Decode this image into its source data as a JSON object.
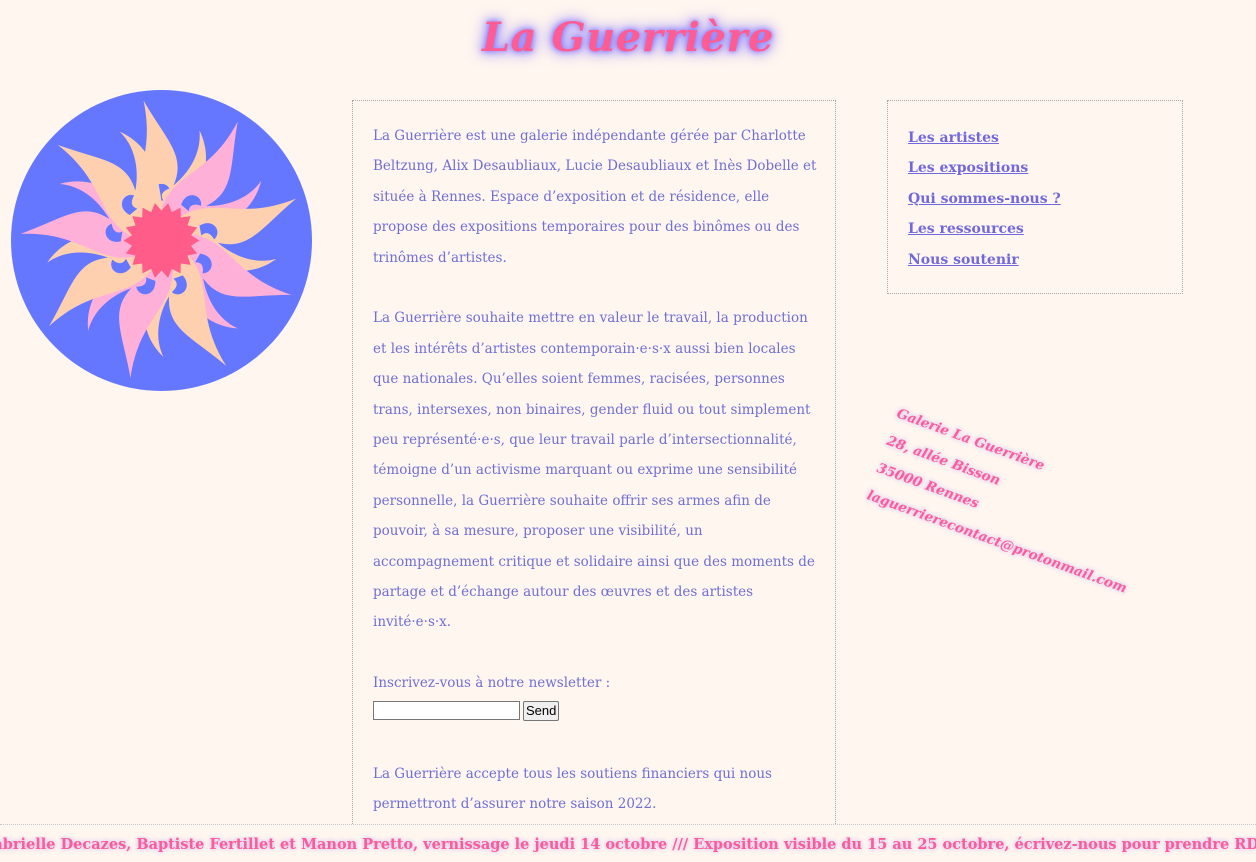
{
  "header": {
    "title": "La Guerrière"
  },
  "logo": {
    "icon": "sun-flower-logo-icon",
    "colors": {
      "circle": "#6677ff",
      "rays_light": "#ffd0b0",
      "rays_pink": "#ffb0d8",
      "center": "#ff5c8a"
    }
  },
  "main": {
    "paragraphs": [
      "La Guerrière est une galerie indépendante gérée par Charlotte Beltzung, Alix Desaubliaux, Lucie Desaubliaux et Inès Dobelle et située à Rennes. Espace d’exposition et de résidence, elle propose des expositions temporaires pour des binômes ou des trinômes d’artistes.",
      "La Guerrière souhaite mettre en valeur le travail, la production et les intérêts d’artistes contemporain·e·s·x aussi bien locales que nationales. Qu’elles soient femmes, racisées, personnes trans, intersexes, non binaires, gender fluid ou tout simplement peu représenté·e·s, que leur travail parle d’intersectionnalité, témoigne d’un activisme marquant ou exprime une sensibilité personnelle, la Guerrière souhaite offrir ses armes afin de pouvoir, à sa mesure, proposer une visibilité, un accompagnement critique et solidaire ainsi que des moments de partage et d’échange autour des œuvres et des artistes invité·e·s·x."
    ],
    "newsletter": {
      "label": "Inscrivez-vous à notre newsletter :",
      "input_value": "",
      "send_label": "Send"
    },
    "support_text": "La Guerrière accepte tous les soutiens financiers qui nous permettront d’assurer notre saison 2022."
  },
  "nav": {
    "items": [
      {
        "label": "Les artistes"
      },
      {
        "label": "Les expositions"
      },
      {
        "label": "Qui sommes-nous ?"
      },
      {
        "label": "Les ressources"
      },
      {
        "label": "Nous soutenir"
      }
    ]
  },
  "address": {
    "name": "Galerie La Guerrière",
    "street": "28, allée Bisson",
    "city": "35000 Rennes",
    "email": "laguerrierecontact@protonmail.com"
  },
  "marquee": {
    "text": "Gabrielle Decazes, Baptiste Fertillet et Manon Pretto, vernissage le jeudi 14 octobre /// Exposition visible du 15 au 25 octobre, écrivez-nous pour prendre RDV : laguerrierecontact@protonmail.com"
  },
  "colors": {
    "background": "#fff6ef",
    "text": "#6f6fd4",
    "accent_pink": "#ff5c94",
    "glow": "#8a7bff",
    "link": "#7068dc"
  }
}
